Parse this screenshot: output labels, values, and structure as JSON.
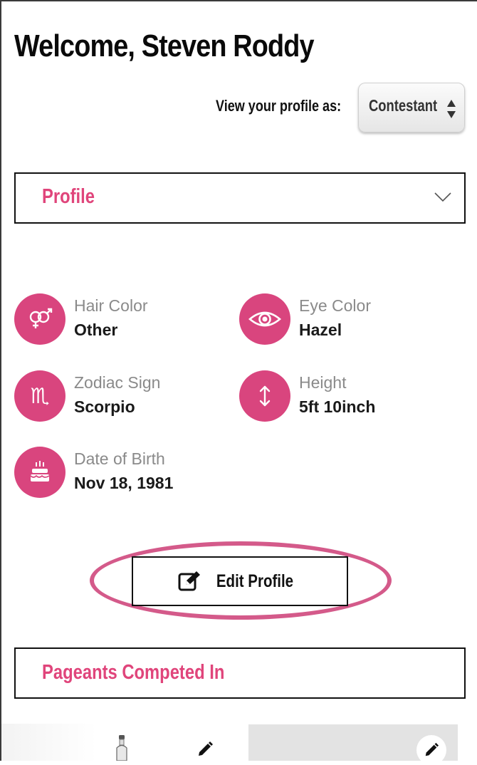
{
  "header": {
    "welcome": "Welcome, Steven Roddy",
    "view_as_label": "View your profile as:",
    "view_as_selected": "Contestant"
  },
  "profile_section": {
    "title": "Profile",
    "attributes": [
      {
        "label": "Hair Color",
        "value": "Other",
        "icon": "gender-icon"
      },
      {
        "label": "Eye Color",
        "value": "Hazel",
        "icon": "eye-icon"
      },
      {
        "label": "Zodiac Sign",
        "value": "Scorpio",
        "icon": "scorpio-icon"
      },
      {
        "label": "Height",
        "value": "5ft 10inch",
        "icon": "height-arrows-icon"
      },
      {
        "label": "Date of Birth",
        "value": "Nov 18, 1981",
        "icon": "birthday-cake-icon"
      }
    ],
    "edit_button_label": "Edit Profile"
  },
  "pageants_section": {
    "title": "Pageants Competed In"
  },
  "colors": {
    "accent": "#e0457b",
    "icon_circle": "#d9457e",
    "highlight_ellipse": "#d45a8a"
  }
}
